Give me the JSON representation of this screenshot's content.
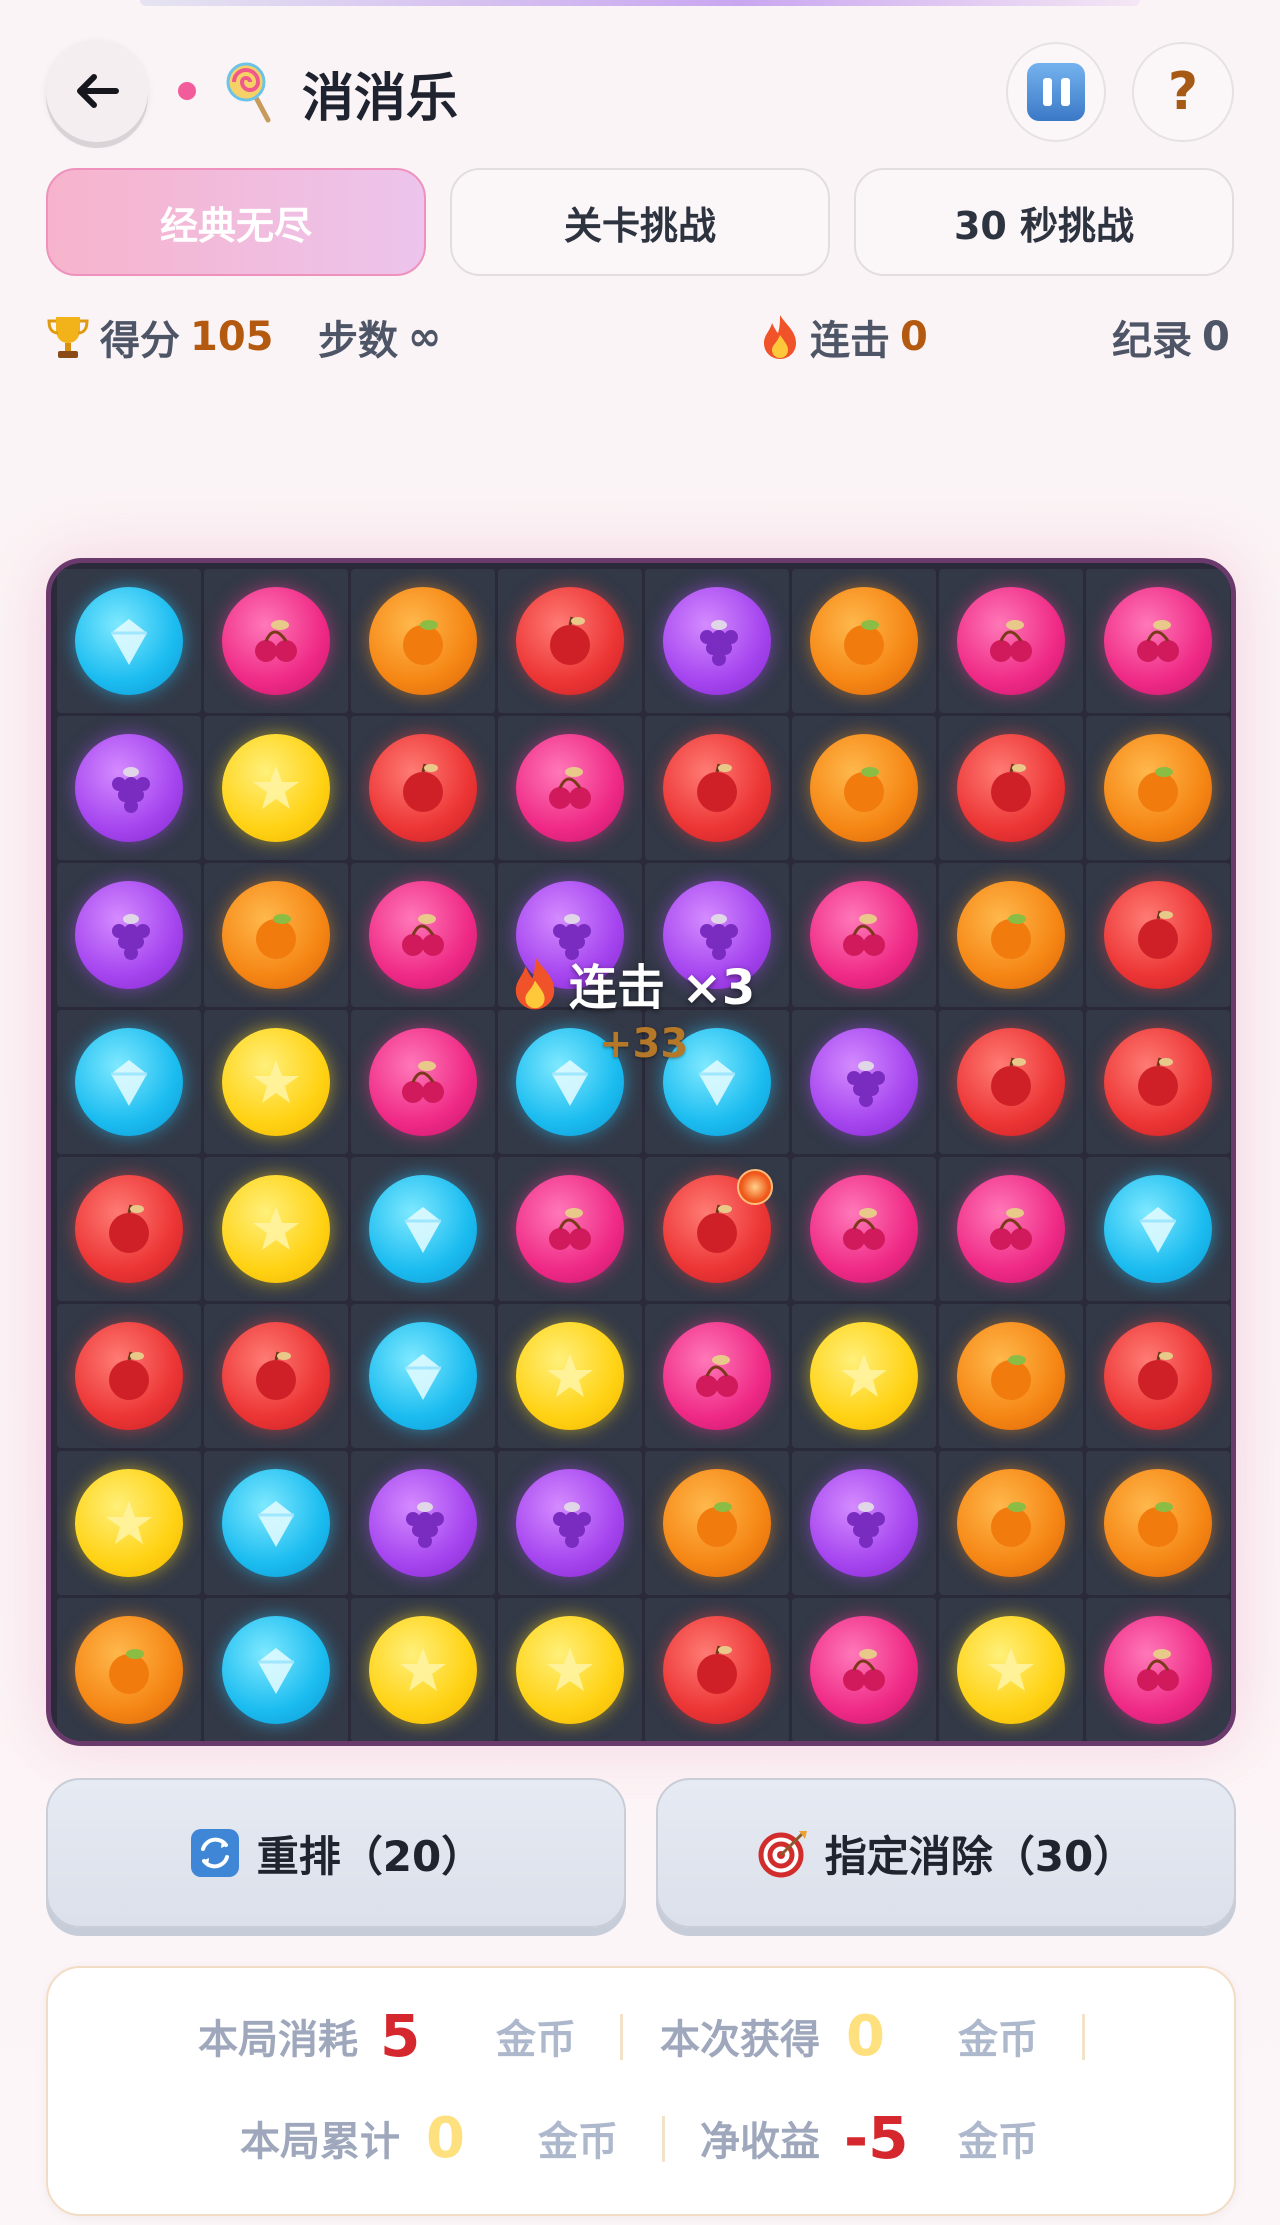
{
  "header": {
    "title": "消消乐",
    "back_icon": "arrow-left-icon",
    "help_label": "?"
  },
  "tabs": [
    {
      "label": "经典无尽",
      "active": true
    },
    {
      "label": "关卡挑战",
      "active": false
    },
    {
      "label": "30 秒挑战",
      "active": false
    }
  ],
  "stats": {
    "score_label": "得分",
    "score_value": "105",
    "steps_label": "步数",
    "steps_value": "∞",
    "combo_label": "连击",
    "combo_value": "0",
    "record_label": "纪录",
    "record_value": "0"
  },
  "board": {
    "rows": [
      [
        "blue",
        "pink",
        "orange",
        "red",
        "purple",
        "orange",
        "pink",
        "pink"
      ],
      [
        "purple",
        "yellow",
        "red",
        "pink",
        "red",
        "orange",
        "red",
        "orange"
      ],
      [
        "purple",
        "orange",
        "pink",
        "purple",
        "purple",
        "pink",
        "orange",
        "red"
      ],
      [
        "blue",
        "yellow",
        "pink",
        "blue",
        "blue",
        "purple",
        "red",
        "red"
      ],
      [
        "red",
        "yellow",
        "blue",
        "pink",
        "red",
        "pink",
        "pink",
        "blue"
      ],
      [
        "red",
        "red",
        "blue",
        "yellow",
        "pink",
        "yellow",
        "orange",
        "red"
      ],
      [
        "yellow",
        "blue",
        "purple",
        "purple",
        "orange",
        "purple",
        "orange",
        "orange"
      ],
      [
        "orange",
        "blue",
        "yellow",
        "yellow",
        "red",
        "pink",
        "yellow",
        "pink"
      ]
    ],
    "combo_popup": "连击 ×3",
    "combo_points": "+33"
  },
  "actions": {
    "shuffle_label": "重排（20）",
    "target_label": "指定消除（30）"
  },
  "summary": {
    "spent_label": "本局消耗",
    "spent_value": "5",
    "gained_label": "本次获得",
    "gained_value": "0",
    "total_label": "本局累计",
    "total_value": "0",
    "net_label": "净收益",
    "net_value": "-5",
    "unit": "金币"
  },
  "colors": {
    "accent_pink": "#ee92bd",
    "board_bg": "#2b2a3a",
    "score_brown": "#b45a10",
    "loss_red": "#d5282e"
  }
}
